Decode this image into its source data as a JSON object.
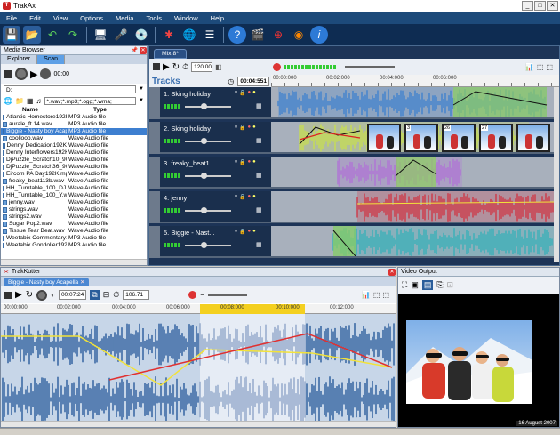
{
  "app": {
    "title": "TrakAx"
  },
  "menu": [
    "File",
    "Edit",
    "View",
    "Options",
    "Media",
    "Tools",
    "Window",
    "Help"
  ],
  "media_browser": {
    "title": "Media Browser",
    "tabs": [
      "Explorer",
      "Scan"
    ],
    "time": "00:00",
    "drive": "D:",
    "filter": "*.wav;*.mp3;*.ogg;*.wma;",
    "columns": [
      "Name",
      "Type"
    ],
    "files": [
      {
        "name": "Atlantic Homestore192K",
        "type": "MP3 Audio file"
      },
      {
        "name": "aurale_ft.14.wav",
        "type": "MP3 Audio file"
      },
      {
        "name": "Biggie - Nasty boy Acape",
        "type": "MP3 Audio file",
        "selected": true
      },
      {
        "name": "coolloop.wav",
        "type": "Wave Audio file"
      },
      {
        "name": "Denny Dedication192K",
        "type": "Wave Audio file"
      },
      {
        "name": "Denny Interflowers192K",
        "type": "Wave Audio file"
      },
      {
        "name": "DjPuzzle_Scratch10_90",
        "type": "Wave Audio file"
      },
      {
        "name": "DjPuzzle_Scratch36_90",
        "type": "Wave Audio file"
      },
      {
        "name": "Eircom PA Day192K.mp",
        "type": "Wave Audio file"
      },
      {
        "name": "freaky_beat113b.wav",
        "type": "Wave Audio file"
      },
      {
        "name": "HH_Turntable_100_DJ.w",
        "type": "Wave Audio file"
      },
      {
        "name": "HH_Turntable_100_Y.w",
        "type": "Wave Audio file"
      },
      {
        "name": "jenny.wav",
        "type": "Wave Audio file"
      },
      {
        "name": "strings.wav",
        "type": "Wave Audio file"
      },
      {
        "name": "strings2.wav",
        "type": "Wave Audio file"
      },
      {
        "name": "Sugar Pop2.wav",
        "type": "Wave Audio file"
      },
      {
        "name": "Tissue Tear Beat.wav",
        "type": "Wave Audio file"
      },
      {
        "name": "Weetabix Commentary19",
        "type": "MP3 Audio file"
      },
      {
        "name": "Weetabix Gondolier192K",
        "type": "MP3 Audio file"
      }
    ]
  },
  "mix": {
    "tab": "Mix 8*",
    "bpm": "120.00",
    "tracks_label": "Tracks",
    "time": "00:04:551",
    "ruler": [
      "00:00:000",
      "00:02:000",
      "00:04:000",
      "00:06:000"
    ],
    "tracks": [
      {
        "number": "1.",
        "name": "Sking holiday",
        "color": "#3a7fd0"
      },
      {
        "number": "2.",
        "name": "Sking holiday",
        "color": "#c8e04a"
      },
      {
        "number": "3.",
        "name": "freaky_beat1...",
        "color": "#b070d8"
      },
      {
        "number": "4.",
        "name": "jenny",
        "color": "#d03040"
      },
      {
        "number": "5.",
        "name": "Biggie - Nast...",
        "color": "#30b0b8"
      }
    ],
    "video_frame_labels": [
      "3",
      "26",
      "27"
    ]
  },
  "kutter": {
    "title": "TrakKutter",
    "tab": "Biggie - Nasty boy Acapella",
    "time": "00:07:24",
    "bpm": "106.71",
    "ruler": [
      "00:00:000",
      "00:02:000",
      "00:04:000",
      "00:06:000",
      "00:08:000",
      "00:10:000",
      "00:12:000"
    ]
  },
  "video": {
    "title": "Video Output",
    "date": "16 August 2007"
  }
}
